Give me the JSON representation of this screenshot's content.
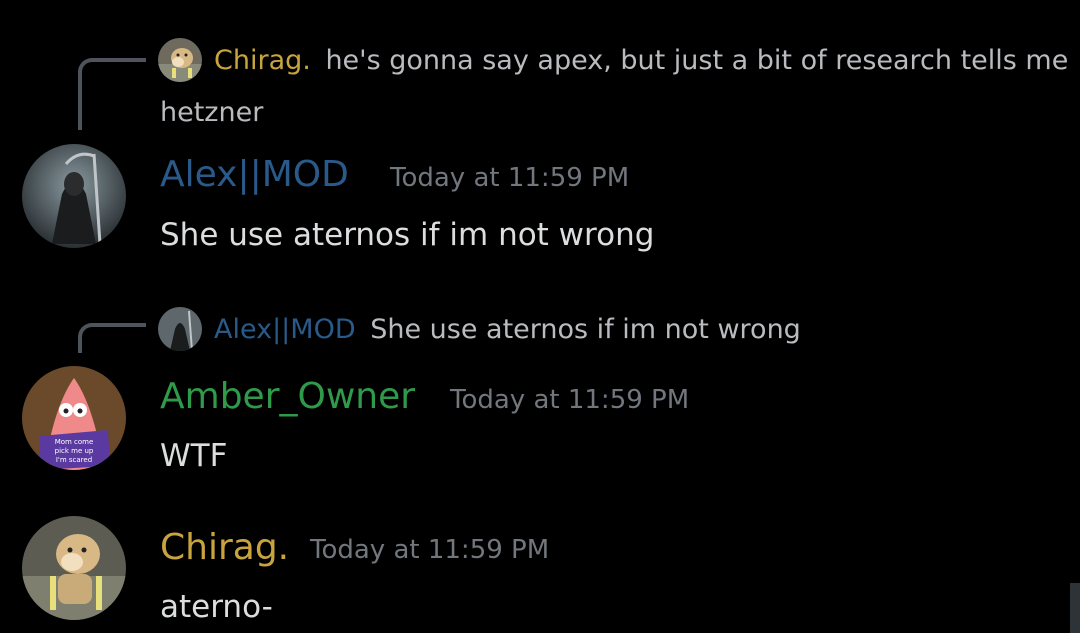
{
  "colors": {
    "background": "#000000",
    "chirag": "#c9a43e",
    "alex": "#2a5a8a",
    "amber": "#2f9a4a",
    "timestamp": "#72767d",
    "message_text": "#dcddde",
    "reply_text": "#b9bbbe"
  },
  "messages": [
    {
      "reply": {
        "author": "Chirag.",
        "text_line1": "he's gonna say apex, but just a bit of research tells me",
        "text_line2": "hetzner",
        "avatar_icon": "doge-avatar"
      },
      "author": "Alex||MOD",
      "timestamp": "Today at 11:59 PM",
      "content": "She use aternos if im not wrong",
      "avatar_icon": "reaper-avatar"
    },
    {
      "reply": {
        "author": "Alex||MOD",
        "text_line1": "She use aternos if im not wrong",
        "avatar_icon": "reaper-avatar"
      },
      "author": "Amber_Owner",
      "timestamp": "Today at 11:59 PM",
      "content": "WTF",
      "avatar_icon": "patrick-avatar"
    },
    {
      "author": "Chirag.",
      "timestamp": "Today at 11:59 PM",
      "content": "aterno-",
      "avatar_icon": "doge-avatar"
    }
  ]
}
